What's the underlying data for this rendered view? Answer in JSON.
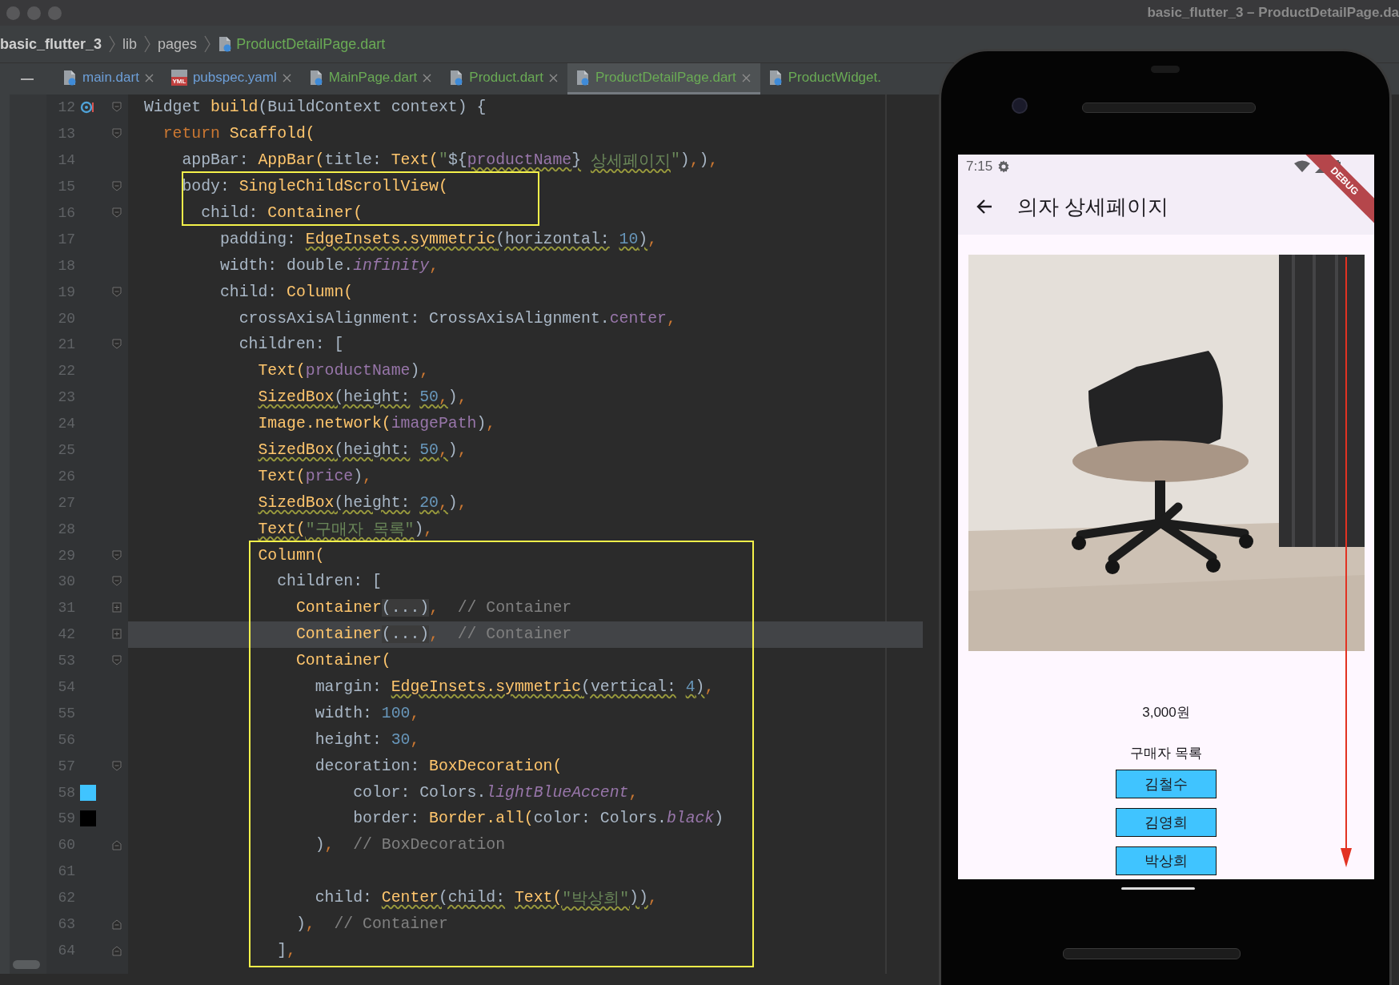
{
  "window": {
    "title": "basic_flutter_3 – ProductDetailPage.da"
  },
  "breadcrumb": [
    {
      "label": "basic_flutter_3",
      "kind": "project"
    },
    {
      "label": "lib",
      "kind": "folder"
    },
    {
      "label": "pages",
      "kind": "folder"
    },
    {
      "label": "ProductDetailPage.dart",
      "kind": "file"
    }
  ],
  "tabs": [
    {
      "label": "main.dart",
      "kind": "dart",
      "color": "#6d9fd8",
      "selected": false,
      "closable": true
    },
    {
      "label": "pubspec.yaml",
      "kind": "yaml",
      "badge": "YML",
      "color": "#6d9fd8",
      "selected": false,
      "closable": true
    },
    {
      "label": "MainPage.dart",
      "kind": "dart",
      "color": "#6aab55",
      "selected": false,
      "closable": true
    },
    {
      "label": "Product.dart",
      "kind": "dart",
      "color": "#6aab55",
      "selected": false,
      "closable": true
    },
    {
      "label": "ProductDetailPage.dart",
      "kind": "dart",
      "color": "#6aab55",
      "selected": true,
      "closable": true
    },
    {
      "label": "ProductWidget.",
      "kind": "dart",
      "color": "#6aab55",
      "selected": false,
      "closable": false
    }
  ],
  "editor": {
    "lines": [
      {
        "number": "12",
        "current": false,
        "gutter": [
          {
            "kind": "override"
          },
          {
            "kind": "fold_start"
          }
        ],
        "tokens": [
          {
            "text": "Widget ",
            "kind": "plain",
            "underlined": false
          },
          {
            "text": "build",
            "kind": "call",
            "underlined": false
          },
          {
            "text": "(BuildContext context) {",
            "kind": "plain",
            "underlined": false
          }
        ]
      },
      {
        "number": "13",
        "current": false,
        "gutter": [
          {
            "kind": "fold_start"
          }
        ],
        "tokens": [
          {
            "text": "  return ",
            "kind": "keyword",
            "underlined": false
          },
          {
            "text": "Scaffold(",
            "kind": "call",
            "underlined": false
          }
        ]
      },
      {
        "number": "14",
        "current": false,
        "tokens": [
          {
            "text": "    appBar: ",
            "kind": "plain",
            "underlined": false
          },
          {
            "text": "AppBar(",
            "kind": "call",
            "underlined": false
          },
          {
            "text": "title: ",
            "kind": "plain",
            "underlined": false
          },
          {
            "text": "Text(",
            "kind": "call",
            "underlined": false
          },
          {
            "text": "\"",
            "kind": "string",
            "underlined": false
          },
          {
            "text": "${",
            "kind": "plain",
            "underlined": false
          },
          {
            "text": "productName",
            "kind": "field",
            "underlined": true
          },
          {
            "text": "}",
            "kind": "plain",
            "underlined": true
          },
          {
            "text": " 상세페이지",
            "kind": "string",
            "underlined": true
          },
          {
            "text": "\"",
            "kind": "string",
            "underlined": false
          },
          {
            "text": ")",
            "kind": "plain",
            "underlined": false
          },
          {
            "text": ",",
            "kind": "punct",
            "underlined": false
          },
          {
            "text": ")",
            "kind": "plain",
            "underlined": false
          },
          {
            "text": ",",
            "kind": "punct",
            "underlined": false
          }
        ]
      },
      {
        "number": "15",
        "current": false,
        "gutter": [
          {
            "kind": "fold_start"
          }
        ],
        "tokens": [
          {
            "text": "    body: ",
            "kind": "plain",
            "underlined": false
          },
          {
            "text": "SingleChildScrollView(",
            "kind": "call",
            "underlined": false
          }
        ]
      },
      {
        "number": "16",
        "current": false,
        "gutter": [
          {
            "kind": "fold_start"
          }
        ],
        "tokens": [
          {
            "text": "      child: ",
            "kind": "plain",
            "underlined": false
          },
          {
            "text": "Container(",
            "kind": "call",
            "underlined": false
          }
        ]
      },
      {
        "number": "17",
        "current": false,
        "tokens": [
          {
            "text": "        padding: ",
            "kind": "plain",
            "underlined": false
          },
          {
            "text": "EdgeInsets.symmetric",
            "kind": "call",
            "underlined": true
          },
          {
            "text": "(horizontal: ",
            "kind": "plain",
            "underlined": true
          },
          {
            "text": "10",
            "kind": "number",
            "underlined": true
          },
          {
            "text": ")",
            "kind": "plain",
            "underlined": true
          },
          {
            "text": ",",
            "kind": "punct",
            "underlined": false
          }
        ]
      },
      {
        "number": "18",
        "current": false,
        "tokens": [
          {
            "text": "        width: double.",
            "kind": "plain",
            "underlined": false
          },
          {
            "text": "infinity",
            "kind": "constant",
            "underlined": false
          },
          {
            "text": ",",
            "kind": "punct",
            "underlined": false
          }
        ]
      },
      {
        "number": "19",
        "current": false,
        "gutter": [
          {
            "kind": "fold_start"
          }
        ],
        "tokens": [
          {
            "text": "        child: ",
            "kind": "plain",
            "underlined": false
          },
          {
            "text": "Column(",
            "kind": "call",
            "underlined": false
          }
        ]
      },
      {
        "number": "20",
        "current": false,
        "tokens": [
          {
            "text": "          crossAxisAlignment: CrossAxisAlignment.",
            "kind": "plain",
            "underlined": false
          },
          {
            "text": "center",
            "kind": "field",
            "underlined": false
          },
          {
            "text": ",",
            "kind": "punct",
            "underlined": false
          }
        ]
      },
      {
        "number": "21",
        "current": false,
        "gutter": [
          {
            "kind": "fold_start"
          }
        ],
        "tokens": [
          {
            "text": "          children: [",
            "kind": "plain",
            "underlined": false
          }
        ]
      },
      {
        "number": "22",
        "current": false,
        "tokens": [
          {
            "text": "            Text(",
            "kind": "call",
            "underlined": false
          },
          {
            "text": "productName",
            "kind": "field",
            "underlined": false
          },
          {
            "text": ")",
            "kind": "plain",
            "underlined": false
          },
          {
            "text": ",",
            "kind": "punct",
            "underlined": false
          }
        ]
      },
      {
        "number": "23",
        "current": false,
        "tokens": [
          {
            "text": "            SizedBox",
            "kind": "call",
            "underlined": true
          },
          {
            "text": "(height: ",
            "kind": "plain",
            "underlined": true
          },
          {
            "text": "50",
            "kind": "number",
            "underlined": true
          },
          {
            "text": ",",
            "kind": "punct",
            "underlined": true
          },
          {
            "text": ")",
            "kind": "plain",
            "underlined": false
          },
          {
            "text": ",",
            "kind": "punct",
            "underlined": false
          }
        ]
      },
      {
        "number": "24",
        "current": false,
        "tokens": [
          {
            "text": "            Image.network(",
            "kind": "call",
            "underlined": false
          },
          {
            "text": "imagePath",
            "kind": "field",
            "underlined": false
          },
          {
            "text": ")",
            "kind": "plain",
            "underlined": false
          },
          {
            "text": ",",
            "kind": "punct",
            "underlined": false
          }
        ]
      },
      {
        "number": "25",
        "current": false,
        "tokens": [
          {
            "text": "            SizedBox",
            "kind": "call",
            "underlined": true
          },
          {
            "text": "(height: ",
            "kind": "plain",
            "underlined": true
          },
          {
            "text": "50",
            "kind": "number",
            "underlined": true
          },
          {
            "text": ",",
            "kind": "punct",
            "underlined": true
          },
          {
            "text": ")",
            "kind": "plain",
            "underlined": false
          },
          {
            "text": ",",
            "kind": "punct",
            "underlined": false
          }
        ]
      },
      {
        "number": "26",
        "current": false,
        "tokens": [
          {
            "text": "            Text(",
            "kind": "call",
            "underlined": false
          },
          {
            "text": "price",
            "kind": "field",
            "underlined": false
          },
          {
            "text": ")",
            "kind": "plain",
            "underlined": false
          },
          {
            "text": ",",
            "kind": "punct",
            "underlined": false
          }
        ]
      },
      {
        "number": "27",
        "current": false,
        "tokens": [
          {
            "text": "            SizedBox",
            "kind": "call",
            "underlined": true
          },
          {
            "text": "(height: ",
            "kind": "plain",
            "underlined": true
          },
          {
            "text": "20",
            "kind": "number",
            "underlined": true
          },
          {
            "text": ",",
            "kind": "punct",
            "underlined": true
          },
          {
            "text": ")",
            "kind": "plain",
            "underlined": false
          },
          {
            "text": ",",
            "kind": "punct",
            "underlined": false
          }
        ]
      },
      {
        "number": "28",
        "current": false,
        "tokens": [
          {
            "text": "            Text(",
            "kind": "call",
            "underlined": true
          },
          {
            "text": "\"구매자 목록\"",
            "kind": "string",
            "underlined": true
          },
          {
            "text": ")",
            "kind": "plain",
            "underlined": false
          },
          {
            "text": ",",
            "kind": "punct",
            "underlined": false
          }
        ]
      },
      {
        "number": "29",
        "current": false,
        "gutter": [
          {
            "kind": "fold_start"
          }
        ],
        "tokens": [
          {
            "text": "            Column(",
            "kind": "call",
            "underlined": false
          }
        ]
      },
      {
        "number": "30",
        "current": false,
        "gutter": [
          {
            "kind": "fold_start"
          }
        ],
        "tokens": [
          {
            "text": "              children: [",
            "kind": "plain",
            "underlined": false
          }
        ]
      },
      {
        "number": "31",
        "current": false,
        "gutter": [
          {
            "kind": "fold_collapsed"
          }
        ],
        "tokens": [
          {
            "text": "                Container",
            "kind": "call",
            "underlined": false
          },
          {
            "text": "(...)",
            "kind": "folded",
            "underlined": false
          },
          {
            "text": ",",
            "kind": "punct",
            "underlined": false
          },
          {
            "text": "  // Container",
            "kind": "comment",
            "underlined": false
          }
        ]
      },
      {
        "number": "42",
        "current": true,
        "gutter": [
          {
            "kind": "fold_collapsed"
          }
        ],
        "tokens": [
          {
            "text": "                Container",
            "kind": "call",
            "underlined": false
          },
          {
            "text": "(...)",
            "kind": "folded",
            "underlined": false
          },
          {
            "text": ",",
            "kind": "punct",
            "underlined": false
          },
          {
            "text": "  // Container",
            "kind": "comment",
            "underlined": false
          }
        ]
      },
      {
        "number": "53",
        "current": false,
        "gutter": [
          {
            "kind": "fold_start"
          }
        ],
        "tokens": [
          {
            "text": "                Container(",
            "kind": "call",
            "underlined": false
          }
        ]
      },
      {
        "number": "54",
        "current": false,
        "tokens": [
          {
            "text": "                  margin: ",
            "kind": "plain",
            "underlined": false
          },
          {
            "text": "EdgeInsets.symmetric",
            "kind": "call",
            "underlined": true
          },
          {
            "text": "(vertical: ",
            "kind": "plain",
            "underlined": true
          },
          {
            "text": "4",
            "kind": "number",
            "underlined": true
          },
          {
            "text": ")",
            "kind": "plain",
            "underlined": true
          },
          {
            "text": ",",
            "kind": "punct",
            "underlined": false
          }
        ]
      },
      {
        "number": "55",
        "current": false,
        "tokens": [
          {
            "text": "                  width: ",
            "kind": "plain",
            "underlined": false
          },
          {
            "text": "100",
            "kind": "number",
            "underlined": false
          },
          {
            "text": ",",
            "kind": "punct",
            "underlined": false
          }
        ]
      },
      {
        "number": "56",
        "current": false,
        "tokens": [
          {
            "text": "                  height: ",
            "kind": "plain",
            "underlined": false
          },
          {
            "text": "30",
            "kind": "number",
            "underlined": false
          },
          {
            "text": ",",
            "kind": "punct",
            "underlined": false
          }
        ]
      },
      {
        "number": "57",
        "current": false,
        "gutter": [
          {
            "kind": "fold_start"
          }
        ],
        "tokens": [
          {
            "text": "                  decoration: ",
            "kind": "plain",
            "underlined": false
          },
          {
            "text": "BoxDecoration(",
            "kind": "call",
            "underlined": false
          }
        ]
      },
      {
        "number": "58",
        "current": false,
        "gutter": [
          {
            "kind": "swatch",
            "color": "#40c4ff"
          }
        ],
        "tokens": [
          {
            "text": "                      color: Colors.",
            "kind": "plain",
            "underlined": false
          },
          {
            "text": "lightBlueAccent",
            "kind": "constant",
            "underlined": false
          },
          {
            "text": ",",
            "kind": "punct",
            "underlined": false
          }
        ]
      },
      {
        "number": "59",
        "current": false,
        "gutter": [
          {
            "kind": "swatch",
            "color": "#000000"
          }
        ],
        "tokens": [
          {
            "text": "                      border: ",
            "kind": "plain",
            "underlined": false
          },
          {
            "text": "Border.all(",
            "kind": "call",
            "underlined": false
          },
          {
            "text": "color: Colors.",
            "kind": "plain",
            "underlined": false
          },
          {
            "text": "black",
            "kind": "constant",
            "underlined": false
          },
          {
            "text": ")",
            "kind": "plain",
            "underlined": false
          }
        ]
      },
      {
        "number": "60",
        "current": false,
        "gutter": [
          {
            "kind": "fold_end"
          }
        ],
        "tokens": [
          {
            "text": "                  )",
            "kind": "plain",
            "underlined": false
          },
          {
            "text": ",",
            "kind": "punct",
            "underlined": false
          },
          {
            "text": "  // BoxDecoration",
            "kind": "comment",
            "underlined": false
          }
        ]
      },
      {
        "number": "61",
        "current": false
      },
      {
        "number": "62",
        "current": false,
        "tokens": [
          {
            "text": "                  child: ",
            "kind": "plain",
            "underlined": false
          },
          {
            "text": "Center",
            "kind": "call",
            "underlined": true
          },
          {
            "text": "(child: ",
            "kind": "plain",
            "underlined": true
          },
          {
            "text": "Text(",
            "kind": "call",
            "underlined": true
          },
          {
            "text": "\"박상희\"",
            "kind": "string",
            "underlined": true
          },
          {
            "text": "))",
            "kind": "plain",
            "underlined": true
          },
          {
            "text": ",",
            "kind": "punct",
            "underlined": false
          }
        ]
      },
      {
        "number": "63",
        "current": false,
        "gutter": [
          {
            "kind": "fold_end"
          }
        ],
        "tokens": [
          {
            "text": "                )",
            "kind": "plain",
            "underlined": false
          },
          {
            "text": ",",
            "kind": "punct",
            "underlined": false
          },
          {
            "text": "  // Container",
            "kind": "comment",
            "underlined": false
          }
        ]
      },
      {
        "number": "64",
        "current": false,
        "gutter": [
          {
            "kind": "fold_end"
          }
        ],
        "tokens": [
          {
            "text": "              ]",
            "kind": "plain",
            "underlined": false
          },
          {
            "text": ",",
            "kind": "punct",
            "underlined": false
          }
        ]
      }
    ]
  },
  "phone": {
    "status_bar": {
      "time": "7:15"
    },
    "debug_banner": "DEBUG",
    "app_bar": {
      "title": "의자 상세페이지"
    },
    "image": {
      "kind": "picture"
    },
    "price": "3,000원",
    "buyers_heading": "구매자 목록",
    "buyers": [
      "김철수",
      "김영희",
      "박상희"
    ]
  }
}
